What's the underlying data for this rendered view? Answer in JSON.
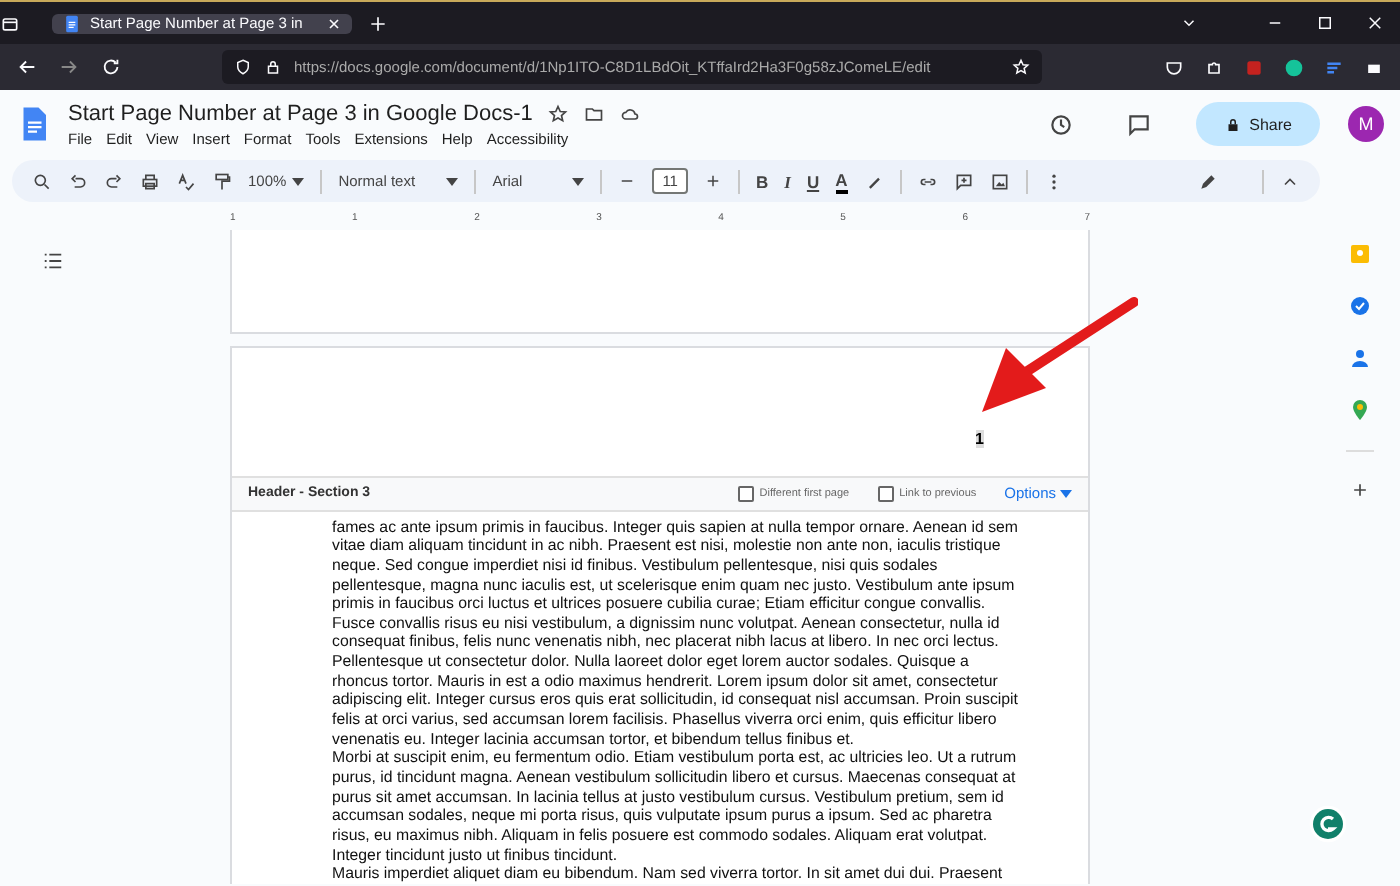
{
  "browser": {
    "tab_title": "Start Page Number at Page 3 in",
    "url": "https://docs.google.com/document/d/1Np1ITO-C8D1LBdOit_KTffaIrd2Ha3F0g58zJComeLE/edit"
  },
  "document": {
    "title": "Start Page Number at Page 3 in Google Docs-1",
    "share_label": "Share",
    "avatar": "M"
  },
  "menu": [
    "File",
    "Edit",
    "View",
    "Insert",
    "Format",
    "Tools",
    "Extensions",
    "Help",
    "Accessibility"
  ],
  "toolbar": {
    "zoom": "100%",
    "style": "Normal text",
    "font": "Arial",
    "font_size": "11",
    "format_buttons": [
      "B",
      "I",
      "U",
      "A"
    ]
  },
  "ruler": [
    "1",
    "1",
    "2",
    "3",
    "4",
    "5",
    "6",
    "7"
  ],
  "header": {
    "page_number": "1",
    "section_label": "Header - Section 3",
    "options": [
      {
        "label": "Different first page",
        "checked": false
      },
      {
        "label": "Link to previous",
        "checked": false
      }
    ],
    "options_menu": "Options"
  },
  "body": [
    {
      "lines": [
        "fames ac ante ipsum primis in faucibus. Integer quis sapien at nulla tempor ornare. Aenean id sem",
        "vitae diam aliquam tincidunt in ac nibh. Praesent est nisi, molestie non ante non, iaculis tristique",
        "neque. Sed congue imperdiet nisi id finibus. Vestibulum pellentesque, nisi quis sodales",
        "pellentesque, magna nunc iaculis est, ut scelerisque enim quam nec justo. Vestibulum ante ipsum",
        "primis in faucibus orci luctus et ultrices posuere cubilia curae; Etiam efficitur congue convallis.",
        "Fusce convallis risus eu nisi vestibulum, a dignissim nunc volutpat. Aenean consectetur, nulla id",
        "consequat finibus, felis nunc venenatis nibh, nec placerat nibh lacus at libero. In nec orci lectus.",
        "Pellentesque ut consectetur dolor. Nulla laoreet dolor eget lorem auctor sodales. Quisque a",
        "rhoncus tortor. Mauris in est a odio maximus hendrerit. Lorem ipsum dolor sit amet, consectetur",
        "adipiscing elit. Integer cursus eros quis erat sollicitudin, id consequat nisl accumsan. Proin suscipit",
        "felis at orci varius, sed accumsan lorem facilisis. Phasellus viverra orci enim, quis efficitur libero",
        "venenatis eu. Integer lacinia accumsan tortor, et bibendum tellus finibus et."
      ]
    },
    {
      "lines": [
        "Morbi at suscipit enim, eu fermentum odio. Etiam vestibulum porta est, ac ultricies leo. Ut a rutrum",
        "purus, id tincidunt magna. Aenean vestibulum sollicitudin libero et cursus. Maecenas consequat at",
        "purus sit amet accumsan. In lacinia tellus at justo vestibulum cursus. Vestibulum pretium, sem id",
        "accumsan sodales, neque mi porta risus, quis vulputate ipsum purus a ipsum. Sed ac pharetra",
        "risus, eu maximus nibh. Aliquam in felis posuere est commodo sodales. Aliquam erat volutpat.",
        "Integer tincidunt justo ut finibus tincidunt."
      ]
    },
    {
      "lines": [
        "Mauris imperdiet aliquet diam eu bibendum. Nam sed viverra tortor. In sit amet dui dui. Praesent"
      ]
    }
  ]
}
